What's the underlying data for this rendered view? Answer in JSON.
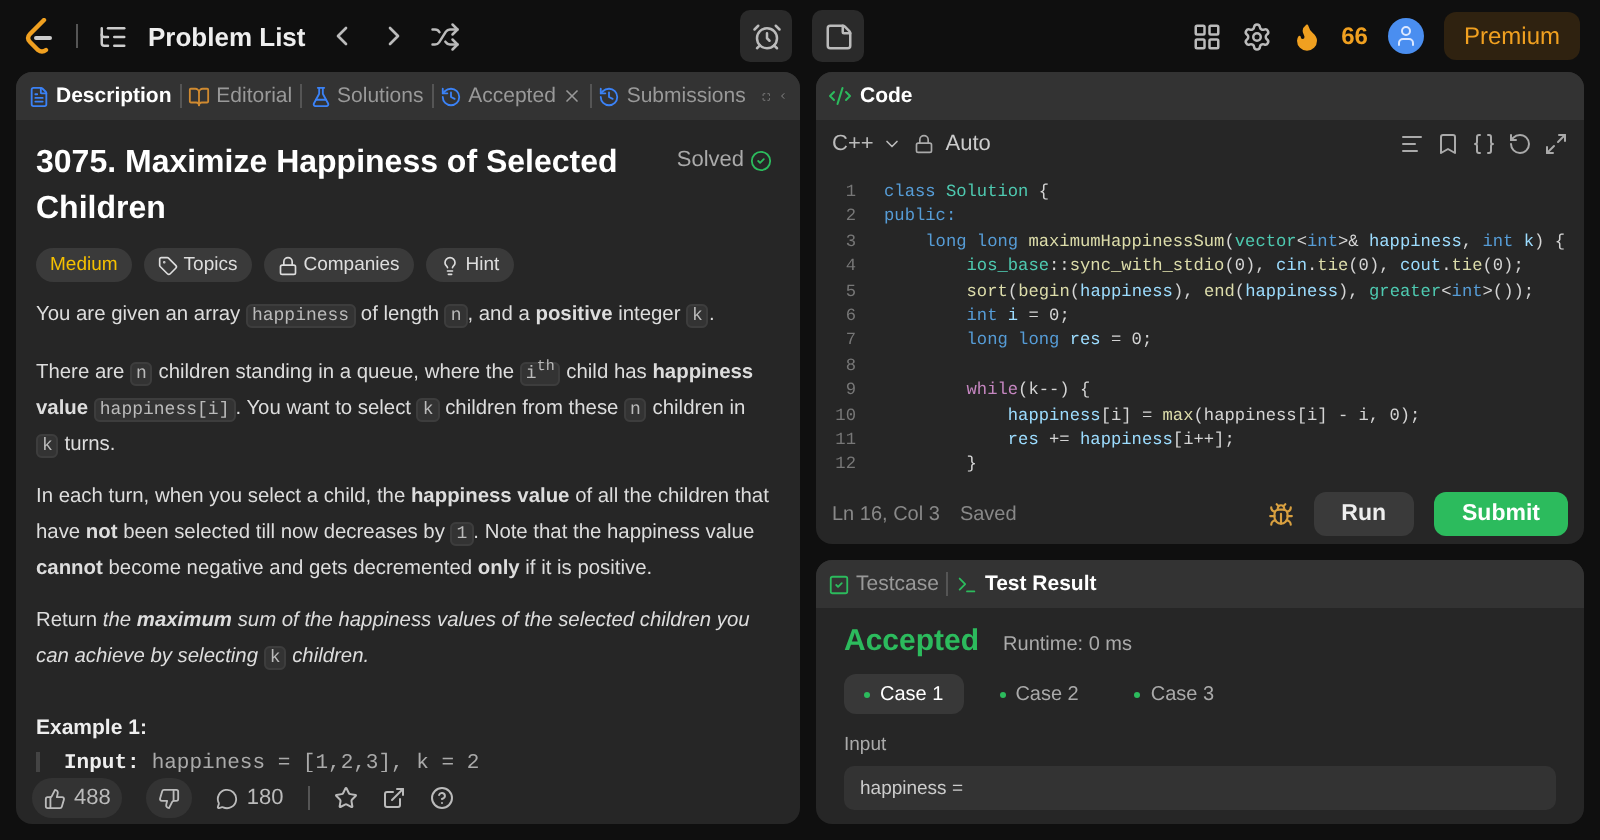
{
  "topbar": {
    "problem_list": "Problem List",
    "streak": "66",
    "premium": "Premium"
  },
  "description_panel": {
    "tabs": [
      {
        "label": "Description",
        "selected": true,
        "closable": false
      },
      {
        "label": "Editorial",
        "selected": false,
        "closable": false
      },
      {
        "label": "Solutions",
        "selected": false,
        "closable": false
      },
      {
        "label": "Accepted",
        "selected": false,
        "closable": true
      },
      {
        "label": "Submissions",
        "selected": false,
        "closable": false
      }
    ],
    "title": "3075. Maximize Happiness of Selected Children",
    "status": "Solved",
    "difficulty": "Medium",
    "tags": [
      {
        "label": "Topics"
      },
      {
        "label": "Companies"
      },
      {
        "label": "Hint"
      }
    ],
    "paragraphs": [
      [
        {
          "kind": "text",
          "text": "You are given an array "
        },
        {
          "kind": "code",
          "text": "happiness"
        },
        {
          "kind": "text",
          "text": " of length "
        },
        {
          "kind": "code",
          "text": "n"
        },
        {
          "kind": "text",
          "text": ", and a **positive** integer "
        },
        {
          "kind": "code",
          "text": "k"
        },
        {
          "kind": "text",
          "text": "."
        }
      ],
      [
        {
          "kind": "text",
          "text": "There are "
        },
        {
          "kind": "code",
          "text": "n"
        },
        {
          "kind": "text",
          "text": " children standing in a queue, where the "
        },
        {
          "kind": "code",
          "text": "i$^{th}$"
        },
        {
          "kind": "text",
          "text": " child has **happiness value** "
        },
        {
          "kind": "code",
          "text": "happiness[i]"
        },
        {
          "kind": "text",
          "text": ". You want to select "
        },
        {
          "kind": "code",
          "text": "k"
        },
        {
          "kind": "text",
          "text": " children from these "
        },
        {
          "kind": "code",
          "text": "n"
        },
        {
          "kind": "text",
          "text": " children in "
        },
        {
          "kind": "code",
          "text": "k"
        },
        {
          "kind": "text",
          "text": " turns."
        }
      ],
      [
        {
          "kind": "text",
          "text": "In each turn, when you select a child, the **happiness value** of all the children that have **not** been selected till now decreases by "
        },
        {
          "kind": "code",
          "text": "1"
        },
        {
          "kind": "text",
          "text": ". Note that the happiness value **cannot** become negative and gets decremented **only** if it is positive."
        }
      ],
      [
        {
          "kind": "text",
          "text": "Return "
        },
        {
          "kind": "italic",
          "text": "the **maximum** sum of the happiness values of the selected children you can achieve by selecting "
        },
        {
          "kind": "code",
          "text": "k"
        },
        {
          "kind": "italic",
          "text": " children."
        }
      ]
    ],
    "example": {
      "heading": "Example 1:",
      "input_label": "Input:",
      "input_value": "happiness = [1,2,3], k = 2"
    },
    "footer": {
      "likes": "488",
      "comments": "180"
    }
  },
  "code_panel": {
    "title": "Code",
    "language": "C++",
    "mode": "Auto",
    "lines": [
      {
        "number": "1",
        "tokens": [
          {
            "kind": "keyword",
            "text": "class"
          },
          {
            "kind": "type",
            "text": " Solution"
          },
          {
            "kind": "plain",
            "text": " {"
          }
        ]
      },
      {
        "number": "2",
        "tokens": [
          {
            "kind": "keyword",
            "text": "public:"
          }
        ]
      },
      {
        "number": "3",
        "tokens": [
          {
            "kind": "keyword",
            "text": "    long long"
          },
          {
            "kind": "function",
            "text": " maximumHappinessSum"
          },
          {
            "kind": "plain",
            "text": "("
          },
          {
            "kind": "type",
            "text": "vector"
          },
          {
            "kind": "plain",
            "text": "<"
          },
          {
            "kind": "keyword",
            "text": "int"
          },
          {
            "kind": "plain",
            "text": ">& "
          },
          {
            "kind": "variable",
            "text": "happiness"
          },
          {
            "kind": "plain",
            "text": ", "
          },
          {
            "kind": "keyword",
            "text": "int"
          },
          {
            "kind": "variable",
            "text": " k"
          },
          {
            "kind": "plain",
            "text": ") {"
          }
        ]
      },
      {
        "number": "4",
        "tokens": [
          {
            "kind": "type",
            "text": "        ios_base"
          },
          {
            "kind": "plain",
            "text": "::"
          },
          {
            "kind": "function",
            "text": "sync_with_stdio"
          },
          {
            "kind": "plain",
            "text": "(0), "
          },
          {
            "kind": "variable",
            "text": "cin"
          },
          {
            "kind": "plain",
            "text": "."
          },
          {
            "kind": "function",
            "text": "tie"
          },
          {
            "kind": "plain",
            "text": "(0), "
          },
          {
            "kind": "variable",
            "text": "cout"
          },
          {
            "kind": "plain",
            "text": "."
          },
          {
            "kind": "function",
            "text": "tie"
          },
          {
            "kind": "plain",
            "text": "(0);"
          }
        ]
      },
      {
        "number": "5",
        "tokens": [
          {
            "kind": "function",
            "text": "        sort"
          },
          {
            "kind": "plain",
            "text": "("
          },
          {
            "kind": "function",
            "text": "begin"
          },
          {
            "kind": "plain",
            "text": "("
          },
          {
            "kind": "variable",
            "text": "happiness"
          },
          {
            "kind": "plain",
            "text": "), "
          },
          {
            "kind": "function",
            "text": "end"
          },
          {
            "kind": "plain",
            "text": "("
          },
          {
            "kind": "variable",
            "text": "happiness"
          },
          {
            "kind": "plain",
            "text": "), "
          },
          {
            "kind": "type",
            "text": "greater"
          },
          {
            "kind": "plain",
            "text": "<"
          },
          {
            "kind": "keyword",
            "text": "int"
          },
          {
            "kind": "plain",
            "text": ">());"
          }
        ]
      },
      {
        "number": "6",
        "tokens": [
          {
            "kind": "keyword",
            "text": "        int"
          },
          {
            "kind": "variable",
            "text": " i"
          },
          {
            "kind": "plain",
            "text": " = 0;"
          }
        ]
      },
      {
        "number": "7",
        "tokens": [
          {
            "kind": "keyword",
            "text": "        long long"
          },
          {
            "kind": "variable",
            "text": " res"
          },
          {
            "kind": "plain",
            "text": " = 0;"
          }
        ]
      },
      {
        "number": "8"
      },
      {
        "number": "9",
        "tokens": [
          {
            "kind": "control",
            "text": "        while"
          },
          {
            "kind": "plain",
            "text": "(k--) {"
          }
        ]
      },
      {
        "number": "10",
        "tokens": [
          {
            "kind": "variable",
            "text": "            happiness"
          },
          {
            "kind": "plain",
            "text": "[i] = "
          },
          {
            "kind": "function",
            "text": "max"
          },
          {
            "kind": "plain",
            "text": "(happiness[i] - i, 0);"
          }
        ]
      },
      {
        "number": "11",
        "tokens": [
          {
            "kind": "variable",
            "text": "            res"
          },
          {
            "kind": "plain",
            "text": " += "
          },
          {
            "kind": "variable",
            "text": "happiness"
          },
          {
            "kind": "plain",
            "text": "[i++];"
          }
        ]
      },
      {
        "number": "12",
        "tokens": [
          {
            "kind": "plain",
            "text": "        }"
          }
        ]
      }
    ],
    "cursor": "Ln 16, Col 3",
    "save_state": "Saved",
    "run": "Run",
    "submit": "Submit"
  },
  "result_panel": {
    "tabs": [
      {
        "label": "Testcase",
        "selected": false
      },
      {
        "label": "Test Result",
        "selected": true
      }
    ],
    "verdict": "Accepted",
    "runtime": "Runtime: 0 ms",
    "cases": [
      {
        "label": "Case 1",
        "selected": true
      },
      {
        "label": "Case 2",
        "selected": false
      },
      {
        "label": "Case 3",
        "selected": false
      }
    ],
    "input_label": "Input",
    "input_value": "happiness ="
  }
}
